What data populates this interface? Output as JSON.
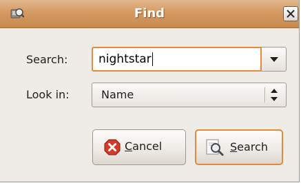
{
  "window": {
    "title": "Find",
    "icon": "app-search-icon"
  },
  "form": {
    "search_label": "Search:",
    "search_value": "nightstar",
    "lookin_label": "Look in:",
    "lookin_value": "Name"
  },
  "buttons": {
    "cancel": {
      "mnemonic": "C",
      "rest": "ancel",
      "icon": "cancel-icon"
    },
    "search": {
      "mnemonic": "S",
      "rest": "earch",
      "icon": "magnifier-icon"
    }
  },
  "colors": {
    "titlebar": "#d49a62",
    "focus_ring": "#e58a3c",
    "window_bg": "#efebe7",
    "cancel_red": "#d23a2a"
  }
}
